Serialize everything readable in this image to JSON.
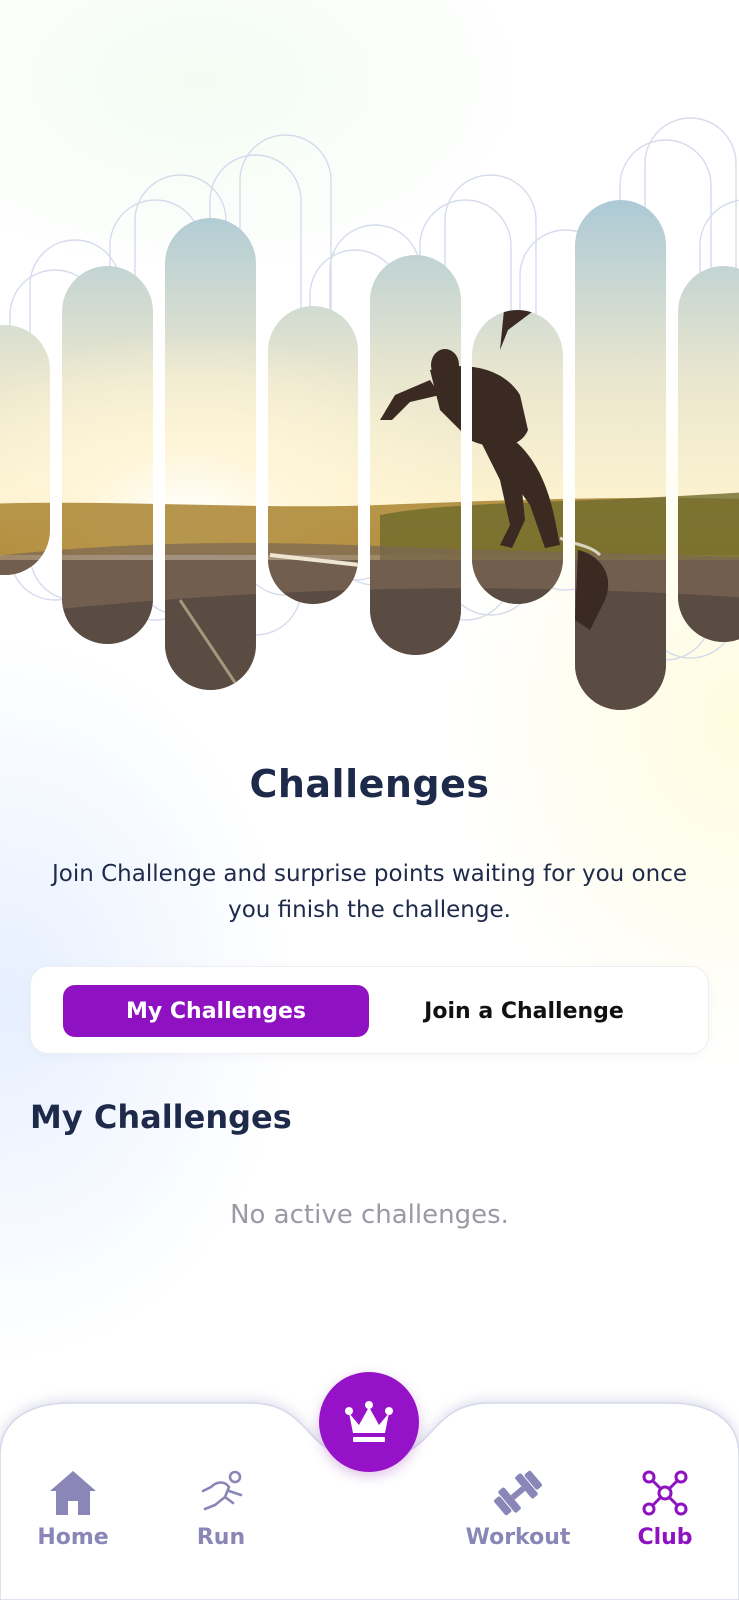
{
  "header": {
    "title": "Challenges",
    "subtitle": "Join Challenge and surprise points waiting for you once you finish the challenge."
  },
  "tabs": {
    "active_label": "My Challenges",
    "inactive_label": "Join a Challenge"
  },
  "section": {
    "title": "My Challenges",
    "empty_message": "No active challenges."
  },
  "nav": {
    "home": "Home",
    "run": "Run",
    "workout": "Workout",
    "club": "Club"
  },
  "icons": {
    "fab": "crown-icon",
    "home": "home-icon",
    "run": "runner-icon",
    "workout": "dumbbell-icon",
    "club": "network-icon"
  },
  "colors": {
    "accent": "#8E12C1",
    "title": "#1E2A4A",
    "nav_inactive": "#8A86B8"
  }
}
